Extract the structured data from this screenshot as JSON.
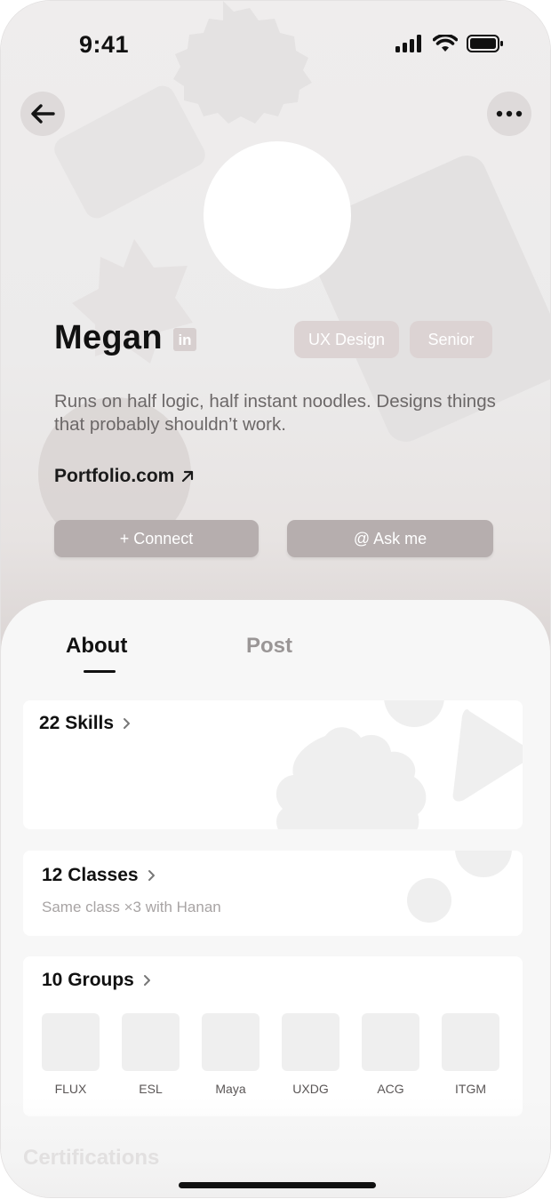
{
  "status_bar": {
    "time": "9:41"
  },
  "icons": {
    "back": "arrow-left-icon",
    "more": "more-horizontal-icon",
    "linkedin": "linkedin-icon",
    "external_link": "arrow-up-right-icon",
    "chevron": "chevron-right-icon",
    "signal": "cellular-signal-icon",
    "wifi": "wifi-icon",
    "battery": "battery-icon"
  },
  "profile": {
    "name": "Megan",
    "linkedin_badge": "in",
    "tags": [
      "UX Design",
      "Senior"
    ],
    "bio": "Runs on half logic, half instant noodles. Designs things that probably shouldn’t work.",
    "portfolio_link": "Portfolio.com",
    "connect_label": "+ Connect",
    "ask_label": "@ Ask me"
  },
  "tabs": {
    "about": "About",
    "post": "Post",
    "active": "About"
  },
  "skills": {
    "title": "22 Skills"
  },
  "classes": {
    "title": "12 Classes",
    "subtitle": "Same class ×3 with Hanan"
  },
  "groups": {
    "title": "10 Groups",
    "items": [
      "FLUX",
      "ESL",
      "Maya",
      "UXDG",
      "ACG",
      "ITGM"
    ]
  },
  "certifications": {
    "title": "Certifications"
  },
  "colors": {
    "accent_button": "#b6aeae",
    "tag_background": "#dcd3d3",
    "text_primary": "#111111",
    "text_muted": "#6c6868"
  }
}
